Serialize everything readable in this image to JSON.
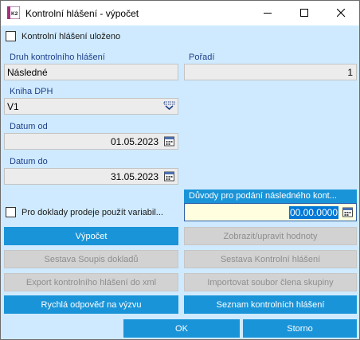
{
  "window": {
    "title": "Kontrolní hlášení - výpočet",
    "app_icon_text": "K2",
    "controls": [
      "minimize",
      "maximize",
      "close"
    ]
  },
  "form": {
    "saved_checkbox": {
      "label": "Kontrolní hlášení uloženo",
      "checked": false
    },
    "type": {
      "label": "Druh kontrolního hlášení",
      "value": "Následné"
    },
    "order": {
      "label": "Pořadí",
      "value": "1"
    },
    "vat_book": {
      "label": "Kniha DPH",
      "value": "V1"
    },
    "date_from": {
      "label": "Datum od",
      "value": "01.05.2023"
    },
    "date_to": {
      "label": "Datum do",
      "value": "31.05.2023"
    },
    "sales_checkbox": {
      "label": "Pro doklady prodeje použít variabil...",
      "checked": false
    },
    "reason_panel": {
      "header": "Důvody pro podání následného kont...",
      "value": "00.00.0000"
    }
  },
  "buttons": {
    "calculate": "Výpočet",
    "show_edit_values": "Zobrazit/upravit hodnoty",
    "report_documents": "Sestava Soupis dokladů",
    "report_control": "Sestava Kontrolní hlášení",
    "export_xml": "Export kontrolního hlášení do xml",
    "import_member": "Importovat soubor člena skupiny",
    "quick_reply": "Rychlá odpověď na výzvu",
    "list_reports": "Seznam kontrolních hlášení",
    "ok": "OK",
    "cancel": "Storno"
  },
  "colors": {
    "client_bg": "#cfeaff",
    "accent": "#1a94d8",
    "label": "#1f3f8a",
    "disabled_bg": "#d2d2d2",
    "disabled_text": "#8e8e8e",
    "edit_bg": "#ffffe0"
  },
  "icons": {
    "app": "k2-app-icon",
    "dropdown": "chevron-down-icon",
    "calendar": "calendar-icon"
  }
}
